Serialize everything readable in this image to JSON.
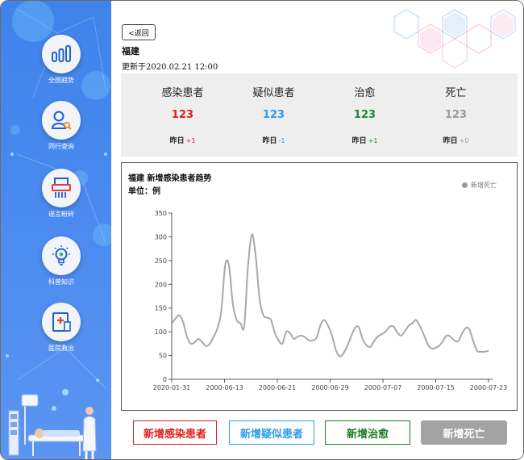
{
  "sidebar": {
    "items": [
      {
        "label": "全国趋势",
        "icon": "bar-chart-icon"
      },
      {
        "label": "同行查询",
        "icon": "user-search-icon"
      },
      {
        "label": "谣言粉碎",
        "icon": "shredder-icon"
      },
      {
        "label": "科普知识",
        "icon": "lightbulb-icon"
      },
      {
        "label": "医院救治",
        "icon": "hospital-icon"
      }
    ]
  },
  "header": {
    "back_label": "<返回",
    "province": "福建",
    "updated": "更新于2020.02.21 12:00"
  },
  "stats": [
    {
      "title": "感染患者",
      "value": "123",
      "color": "#e11d1d",
      "delta_label": "昨日",
      "delta": "+1",
      "delta_color": "#e11d1d"
    },
    {
      "title": "疑似患者",
      "value": "123",
      "color": "#2a9be8",
      "delta_label": "昨日",
      "delta": "-1",
      "delta_color": "#2a9be8"
    },
    {
      "title": "治愈",
      "value": "123",
      "color": "#1a8a2a",
      "delta_label": "昨日",
      "delta": "+1",
      "delta_color": "#1a8a2a"
    },
    {
      "title": "死亡",
      "value": "123",
      "color": "#9a9a9a",
      "delta_label": "昨日",
      "delta": "+0",
      "delta_color": "#9a9a9a"
    }
  ],
  "chart": {
    "title": "福建   新增感染患者趋势",
    "unit": "单位：例",
    "legend": "新增死亡"
  },
  "chart_data": {
    "type": "line",
    "title": "福建   新增感染患者趋势",
    "ylabel": "单位：例",
    "ylim": [
      0,
      350
    ],
    "yticks": [
      0,
      50,
      100,
      150,
      200,
      250,
      300,
      350
    ],
    "xtick_labels": [
      "2020-01-31",
      "2000-06-13",
      "2000-06-21",
      "2000-06-29",
      "2000-07-07",
      "2000-07-15",
      "2000-07-23"
    ],
    "grid": false,
    "legend_position": "top-right",
    "series": [
      {
        "name": "新增死亡",
        "color": "#a8a8a8",
        "values": [
          117,
          128,
          135,
          120,
          90,
          75,
          78,
          85,
          78,
          70,
          75,
          90,
          108,
          145,
          240,
          240,
          160,
          125,
          118,
          112,
          240,
          305,
          260,
          170,
          135,
          130,
          125,
          98,
          82,
          75,
          100,
          97,
          85,
          90,
          92,
          88,
          82,
          82,
          88,
          115,
          125,
          112,
          92,
          62,
          48,
          55,
          70,
          90,
          108,
          110,
          85,
          72,
          68,
          80,
          90,
          95,
          100,
          110,
          112,
          100,
          92,
          100,
          112,
          118,
          125,
          112,
          95,
          75,
          65,
          66,
          70,
          80,
          92,
          90,
          82,
          80,
          95,
          108,
          105,
          80,
          60,
          58,
          58,
          60
        ]
      }
    ]
  },
  "buttons": [
    {
      "label": "新增感染患者",
      "color": "#e11d1d",
      "bg": "#ffffff",
      "border": "#e11d1d"
    },
    {
      "label": "新增疑似患者",
      "color": "#2a9be8",
      "bg": "#ffffff",
      "border": "#2a9be8"
    },
    {
      "label": "新增治愈",
      "color": "#1a7a22",
      "bg": "#ffffff",
      "border": "#1a7a22"
    },
    {
      "label": "新增死亡",
      "color": "#ffffff",
      "bg": "#a3a3a3",
      "border": "#a3a3a3"
    }
  ]
}
